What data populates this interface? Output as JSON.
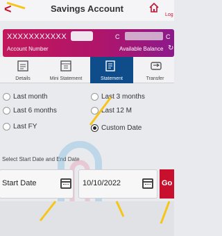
{
  "header": {
    "back_icon": "back-arrow-icon",
    "title": "Savings Account",
    "home_icon": "home-icon",
    "logout_label": "Log"
  },
  "account": {
    "number": "XXXXXXXXXXX",
    "number_label": "Account Number",
    "balance_label": "Available Balance",
    "visible_char_left": "C",
    "visible_char_right": "C"
  },
  "tabs": [
    {
      "label": "Details",
      "icon": "details-icon",
      "active": false
    },
    {
      "label": "Mini Statement",
      "icon": "mini-statement-icon",
      "active": false
    },
    {
      "label": "Statement",
      "icon": "statement-icon",
      "active": true
    },
    {
      "label": "Transfer",
      "icon": "transfer-icon",
      "active": false
    }
  ],
  "period_options": [
    {
      "label": "Last month",
      "checked": false
    },
    {
      "label": "Last 3 months",
      "checked": false
    },
    {
      "label": "Last 6 months",
      "checked": false
    },
    {
      "label": "Last 12 M",
      "checked": false
    },
    {
      "label": "Last FY",
      "checked": false
    },
    {
      "label": "Custom Date",
      "checked": true
    }
  ],
  "date_section": {
    "label": "Select Start Date and End Date",
    "start_placeholder": "Start Date",
    "end_value": "10/10/2022",
    "go_label": "Go"
  },
  "colors": {
    "brand_red": "#c8102e",
    "tab_active": "#0f4c8a",
    "card_start": "#c2185b",
    "card_end": "#8c1a8a"
  }
}
